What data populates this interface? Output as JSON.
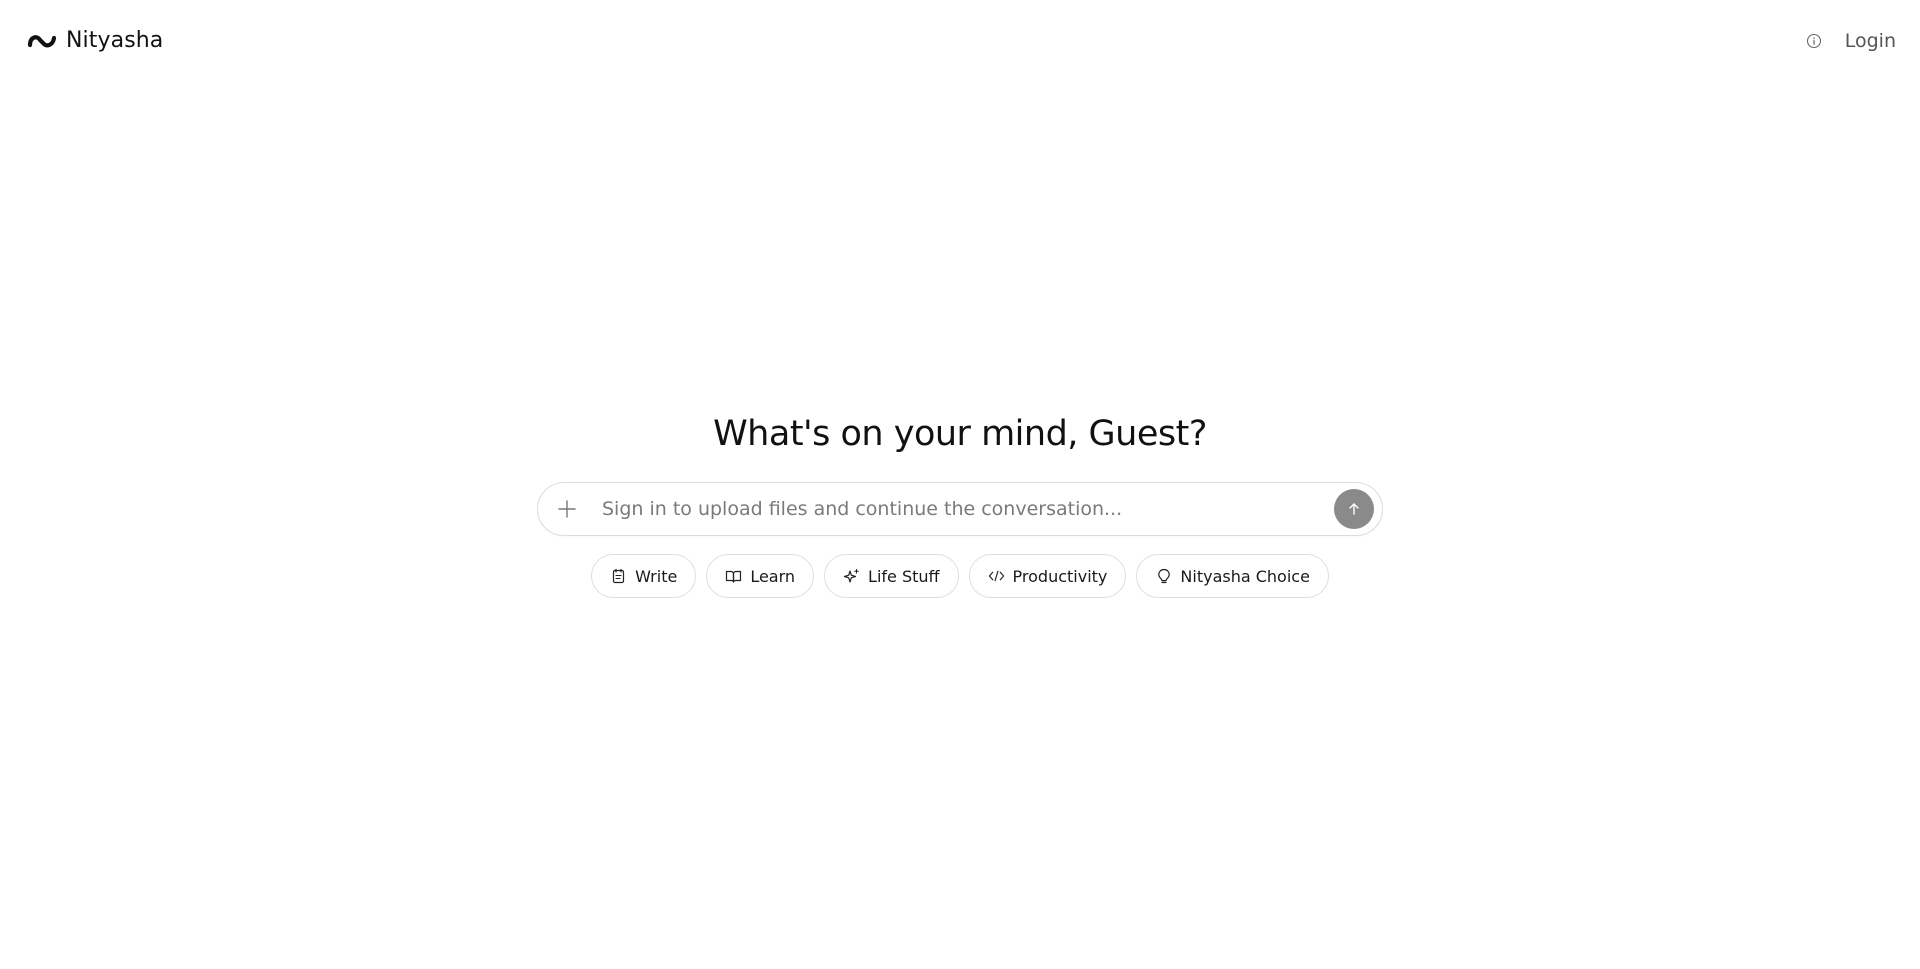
{
  "header": {
    "brand_name": "Nityasha",
    "login_label": "Login"
  },
  "main": {
    "headline": "What's on your mind, Guest?",
    "composer": {
      "placeholder": "Sign in to upload files and continue the conversation..."
    },
    "suggestions": [
      {
        "label": "Write",
        "icon": "notepad-icon"
      },
      {
        "label": "Learn",
        "icon": "open-book-icon"
      },
      {
        "label": "Life Stuff",
        "icon": "sparkle-icon"
      },
      {
        "label": "Productivity",
        "icon": "code-icon"
      },
      {
        "label": "Nityasha Choice",
        "icon": "lightbulb-icon"
      }
    ]
  },
  "colors": {
    "text": "#111111",
    "muted": "#555555",
    "border": "#dcdcdc",
    "send_button": "#8a8a8a"
  }
}
